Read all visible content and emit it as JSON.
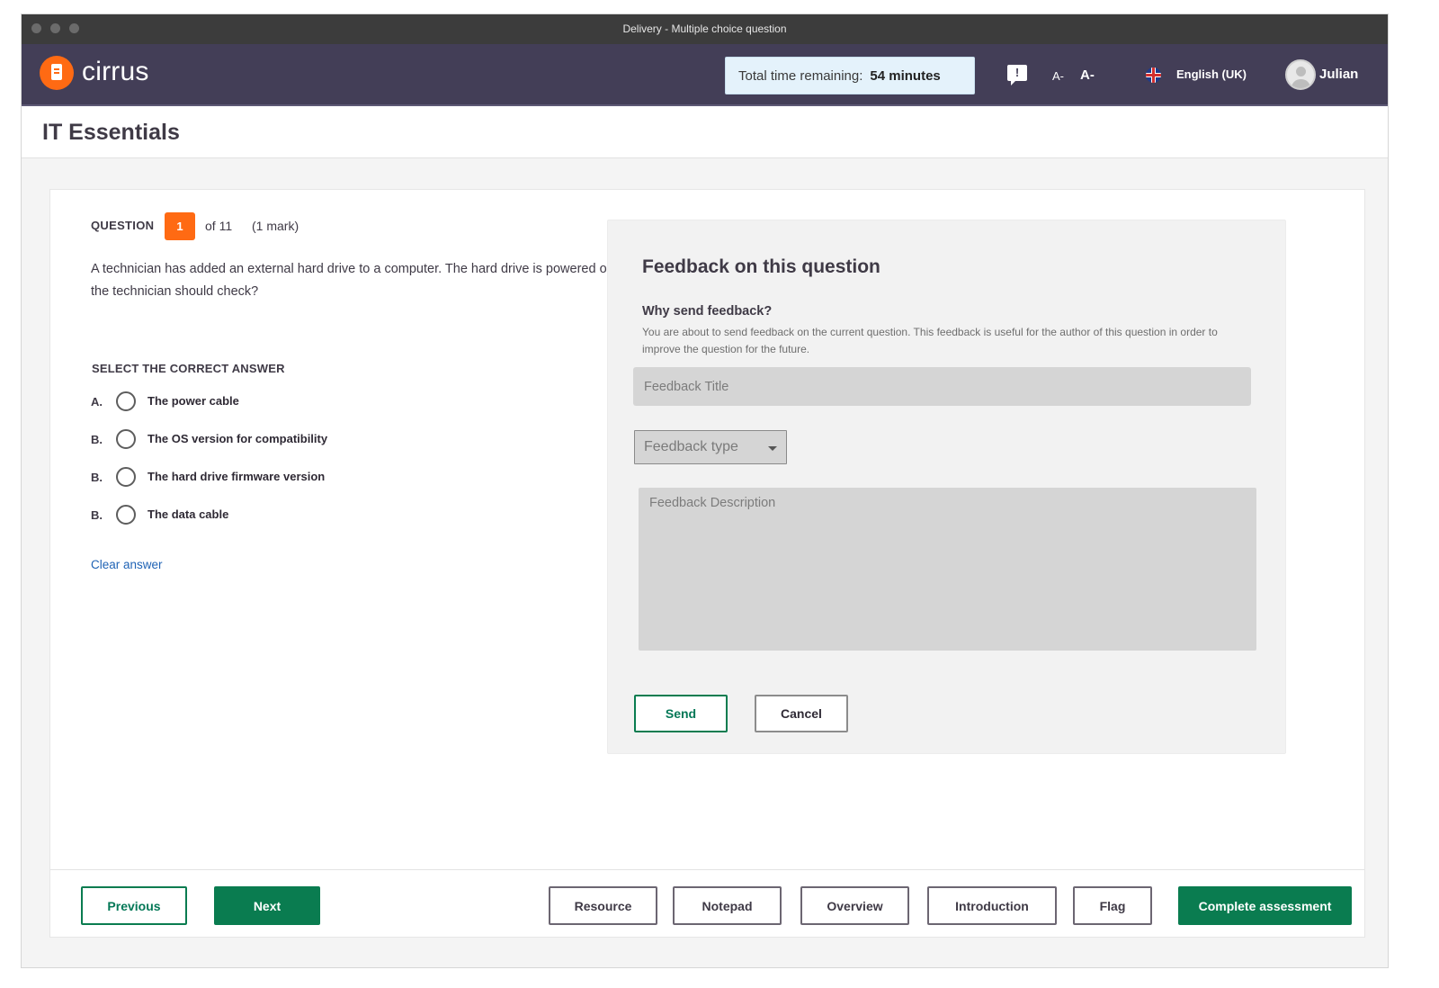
{
  "window": {
    "title": "Delivery - Multiple choice question"
  },
  "brand": {
    "name": "cirrus",
    "accent": "#ff6a13",
    "bar_color": "#433e57",
    "primary_green": "#0a7c50"
  },
  "header": {
    "timer_label": "Total time remaining:",
    "timer_value": "54 minutes",
    "feedback_glyph": "!",
    "font_decrease": "A-",
    "font_increase": "A-",
    "language": "English (UK)",
    "user_name": "Julian"
  },
  "page": {
    "title": "IT Essentials"
  },
  "question": {
    "label": "QUESTION",
    "number": "1",
    "of_text": "of 11",
    "marks": "(1 mark)",
    "text": "A technician has added an external hard drive to a computer. The hard drive is powered on but is not recognised by the computer. What is the first thing the technician should check?",
    "select_label": "SELECT THE CORRECT ANSWER",
    "options": [
      {
        "letter": "A.",
        "text": "The power cable"
      },
      {
        "letter": "B.",
        "text": "The OS version for compatibility"
      },
      {
        "letter": "B.",
        "text": "The hard drive firmware version"
      },
      {
        "letter": "B.",
        "text": "The data cable"
      }
    ],
    "clear_label": "Clear answer"
  },
  "feedback": {
    "title": "Feedback on this question",
    "why_heading": "Why send feedback?",
    "why_text": "You are about to send feedback on the current question. This feedback is useful for the author of this question in order to improve the question for the future.",
    "title_placeholder": "Feedback Title",
    "type_value": "Feedback type",
    "description_placeholder": "Feedback Description",
    "send_label": "Send",
    "cancel_label": "Cancel"
  },
  "footer": {
    "previous": "Previous",
    "next": "Next",
    "resource": "Resource",
    "notepad": "Notepad",
    "overview": "Overview",
    "introduction": "Introduction",
    "flag": "Flag",
    "complete": "Complete assessment"
  }
}
